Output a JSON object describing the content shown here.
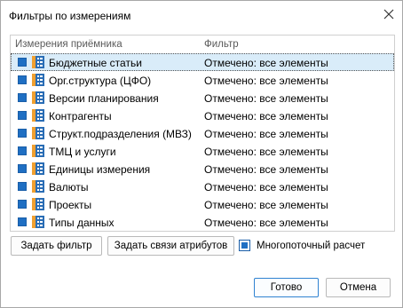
{
  "dialog": {
    "title": "Фильтры по измерениям",
    "close_icon": "close-icon"
  },
  "table": {
    "columns": [
      "Измерения приёмника",
      "Фильтр"
    ],
    "rows": [
      {
        "label": "Бюджетные статьи",
        "filter": "Отмечено: все элементы",
        "checked": true,
        "selected": true
      },
      {
        "label": "Орг.структура (ЦФО)",
        "filter": "Отмечено: все элементы",
        "checked": true,
        "selected": false
      },
      {
        "label": "Версии планирования",
        "filter": "Отмечено: все элементы",
        "checked": true,
        "selected": false
      },
      {
        "label": "Контрагенты",
        "filter": "Отмечено: все элементы",
        "checked": true,
        "selected": false
      },
      {
        "label": "Структ.подразделения (МВЗ)",
        "filter": "Отмечено: все элементы",
        "checked": true,
        "selected": false
      },
      {
        "label": "ТМЦ и услуги",
        "filter": "Отмечено: все элементы",
        "checked": true,
        "selected": false
      },
      {
        "label": "Единицы измерения",
        "filter": "Отмечено: все элементы",
        "checked": true,
        "selected": false
      },
      {
        "label": "Валюты",
        "filter": "Отмечено: все элементы",
        "checked": true,
        "selected": false
      },
      {
        "label": "Проекты",
        "filter": "Отмечено: все элементы",
        "checked": true,
        "selected": false
      },
      {
        "label": "Типы данных",
        "filter": "Отмечено: все элементы",
        "checked": true,
        "selected": false
      }
    ],
    "row_icon": "dimension-icon"
  },
  "actions": {
    "set_filter": "Задать фильтр",
    "set_attr_links": "Задать связи атрибутов",
    "multithread_label": "Многопоточный расчет",
    "multithread_checked": true
  },
  "footer": {
    "ok": "Готово",
    "cancel": "Отмена"
  },
  "colors": {
    "accent": "#1f6fc3",
    "selection": "#d9ecf9",
    "icon_orange": "#f0a030"
  }
}
